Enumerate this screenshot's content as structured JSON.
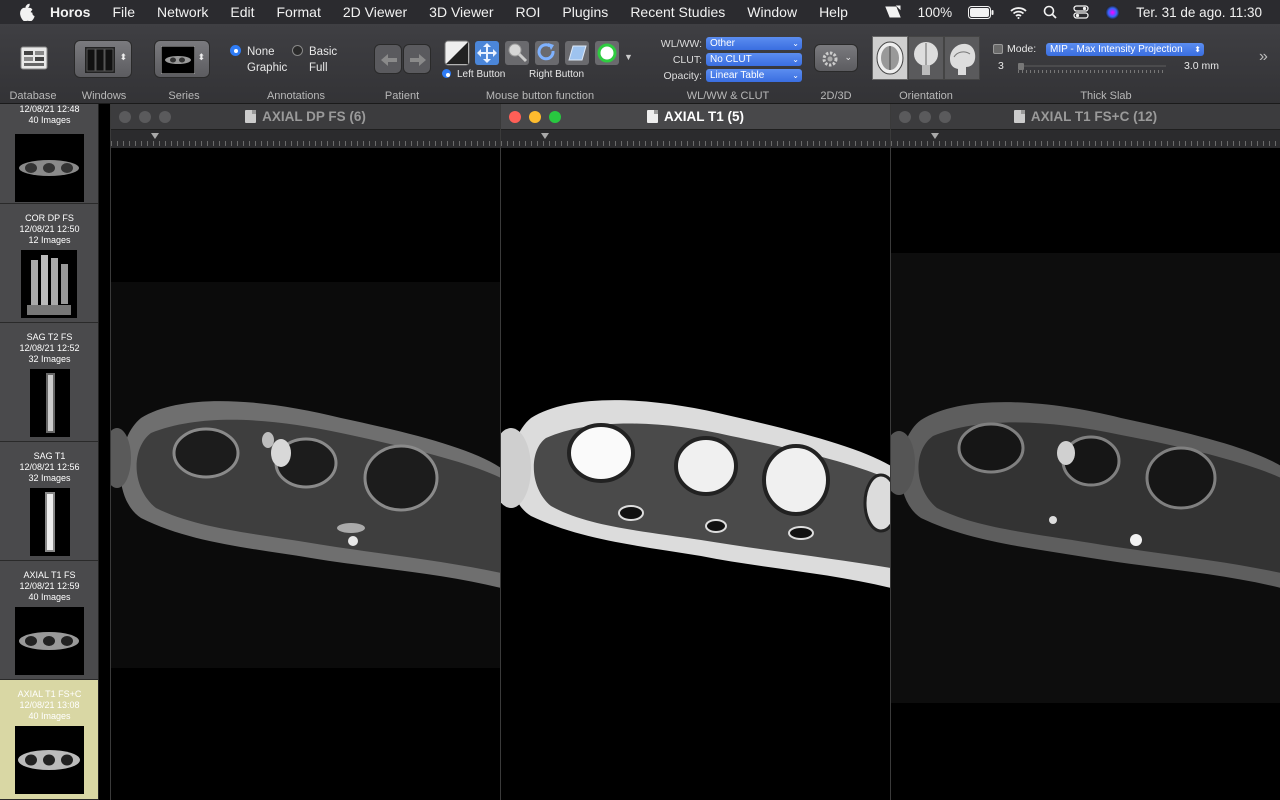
{
  "menubar": {
    "app_name": "Horos",
    "menus": [
      "File",
      "Network",
      "Edit",
      "Format",
      "2D Viewer",
      "3D Viewer",
      "ROI",
      "Plugins",
      "Recent Studies",
      "Window",
      "Help"
    ],
    "battery": "100%",
    "datetime": "Ter. 31 de ago.  11:30"
  },
  "toolbar": {
    "groups": {
      "database": "Database",
      "windows": "Windows",
      "series": "Series",
      "annotations": "Annotations",
      "patient": "Patient",
      "mouse": "Mouse button function",
      "wlww_clut": "WL/WW & CLUT",
      "view2d3d": "2D/3D",
      "orientation": "Orientation",
      "thickslab": "Thick Slab"
    },
    "annotations": {
      "none": "None",
      "graphic": "Graphic",
      "basic": "Basic",
      "full": "Full",
      "selected": "None"
    },
    "mouse": {
      "left": "Left Button",
      "right": "Right Button",
      "selected": "Left Button"
    },
    "wlww": {
      "label_wlww": "WL/WW:",
      "value_wlww": "Other",
      "label_clut": "CLUT:",
      "value_clut": "No CLUT",
      "label_opacity": "Opacity:",
      "value_opacity": "Linear Table"
    },
    "thickslab": {
      "mode_label": "Mode:",
      "mode_value": "MIP - Max Intensity Projection",
      "min": "3",
      "thickness": "3.0 mm"
    }
  },
  "sidebar": {
    "items": [
      {
        "title": "",
        "date": "12/08/21 12:48",
        "count": "40 Images",
        "selected": false
      },
      {
        "title": "COR DP FS",
        "date": "12/08/21 12:50",
        "count": "12 Images",
        "selected": false
      },
      {
        "title": "SAG T2 FS",
        "date": "12/08/21 12:52",
        "count": "32 Images",
        "selected": false
      },
      {
        "title": "SAG T1",
        "date": "12/08/21 12:56",
        "count": "32 Images",
        "selected": false
      },
      {
        "title": "AXIAL T1 FS",
        "date": "12/08/21 12:59",
        "count": "40 Images",
        "selected": false
      },
      {
        "title": "AXIAL T1 FS+C",
        "date": "12/08/21 13:08",
        "count": "40 Images",
        "selected": true
      }
    ]
  },
  "viewers": [
    {
      "title": "AXIAL DP FS (6)",
      "active": false
    },
    {
      "title": "AXIAL T1 (5)",
      "active": true
    },
    {
      "title": "AXIAL T1 FS+C (12)",
      "active": false
    }
  ],
  "colors": {
    "accent": "#2f7cf6",
    "selected_series": "#d9d7a4",
    "close": "#ff5f57",
    "minimize": "#febc2e",
    "zoom": "#28c840"
  }
}
